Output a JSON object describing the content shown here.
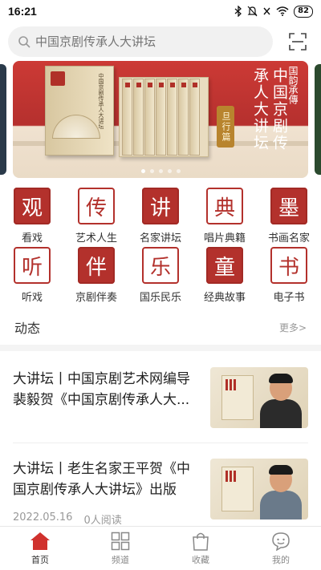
{
  "status_bar": {
    "time": "16:21",
    "battery": "82",
    "icons": [
      "bluetooth-icon",
      "mute-icon",
      "sim-off-icon",
      "wifi-icon",
      "battery-icon"
    ]
  },
  "search": {
    "placeholder": "中国京剧传承人大讲坛",
    "icon": "search-icon",
    "scan_icon": "scan-icon"
  },
  "banner": {
    "logo_text": "国韵承傳",
    "title": "中国京剧传承人大讲坛",
    "tag": "旦行篇",
    "book_text": "中国京剧传承人大讲坛",
    "slide_count": 5,
    "active_slide": 0
  },
  "categories": [
    {
      "glyph": "观",
      "label": "看戏",
      "style": "red"
    },
    {
      "glyph": "传",
      "label": "艺术人生",
      "style": "white"
    },
    {
      "glyph": "讲",
      "label": "名家讲坛",
      "style": "red"
    },
    {
      "glyph": "典",
      "label": "唱片典籍",
      "style": "white"
    },
    {
      "glyph": "墨",
      "label": "书画名家",
      "style": "red"
    },
    {
      "glyph": "听",
      "label": "听戏",
      "style": "white"
    },
    {
      "glyph": "伴",
      "label": "京剧伴奏",
      "style": "red"
    },
    {
      "glyph": "乐",
      "label": "国乐民乐",
      "style": "white"
    },
    {
      "glyph": "童",
      "label": "经典故事",
      "style": "red"
    },
    {
      "glyph": "书",
      "label": "电子书",
      "style": "white"
    }
  ],
  "feed": {
    "section_title": "动态",
    "more_label": "更多>"
  },
  "news": [
    {
      "title": "大讲坛丨中国京剧艺术网编导裴毅贺《中国京剧传承人大...",
      "date": "",
      "reads": ""
    },
    {
      "title": "大讲坛丨老生名家王平贺《中国京剧传承人大讲坛》出版",
      "date": "2022.05.16",
      "reads": "0人阅读"
    }
  ],
  "bottom_nav": [
    {
      "label": "首页",
      "icon": "home-icon",
      "active": true
    },
    {
      "label": "频道",
      "icon": "grid-icon",
      "active": false
    },
    {
      "label": "收藏",
      "icon": "bag-icon",
      "active": false
    },
    {
      "label": "我的",
      "icon": "profile-icon",
      "active": false
    }
  ],
  "colors": {
    "accent": "#b3312c",
    "banner_red": "#cc3a35",
    "nav_active": "#d0312d"
  }
}
